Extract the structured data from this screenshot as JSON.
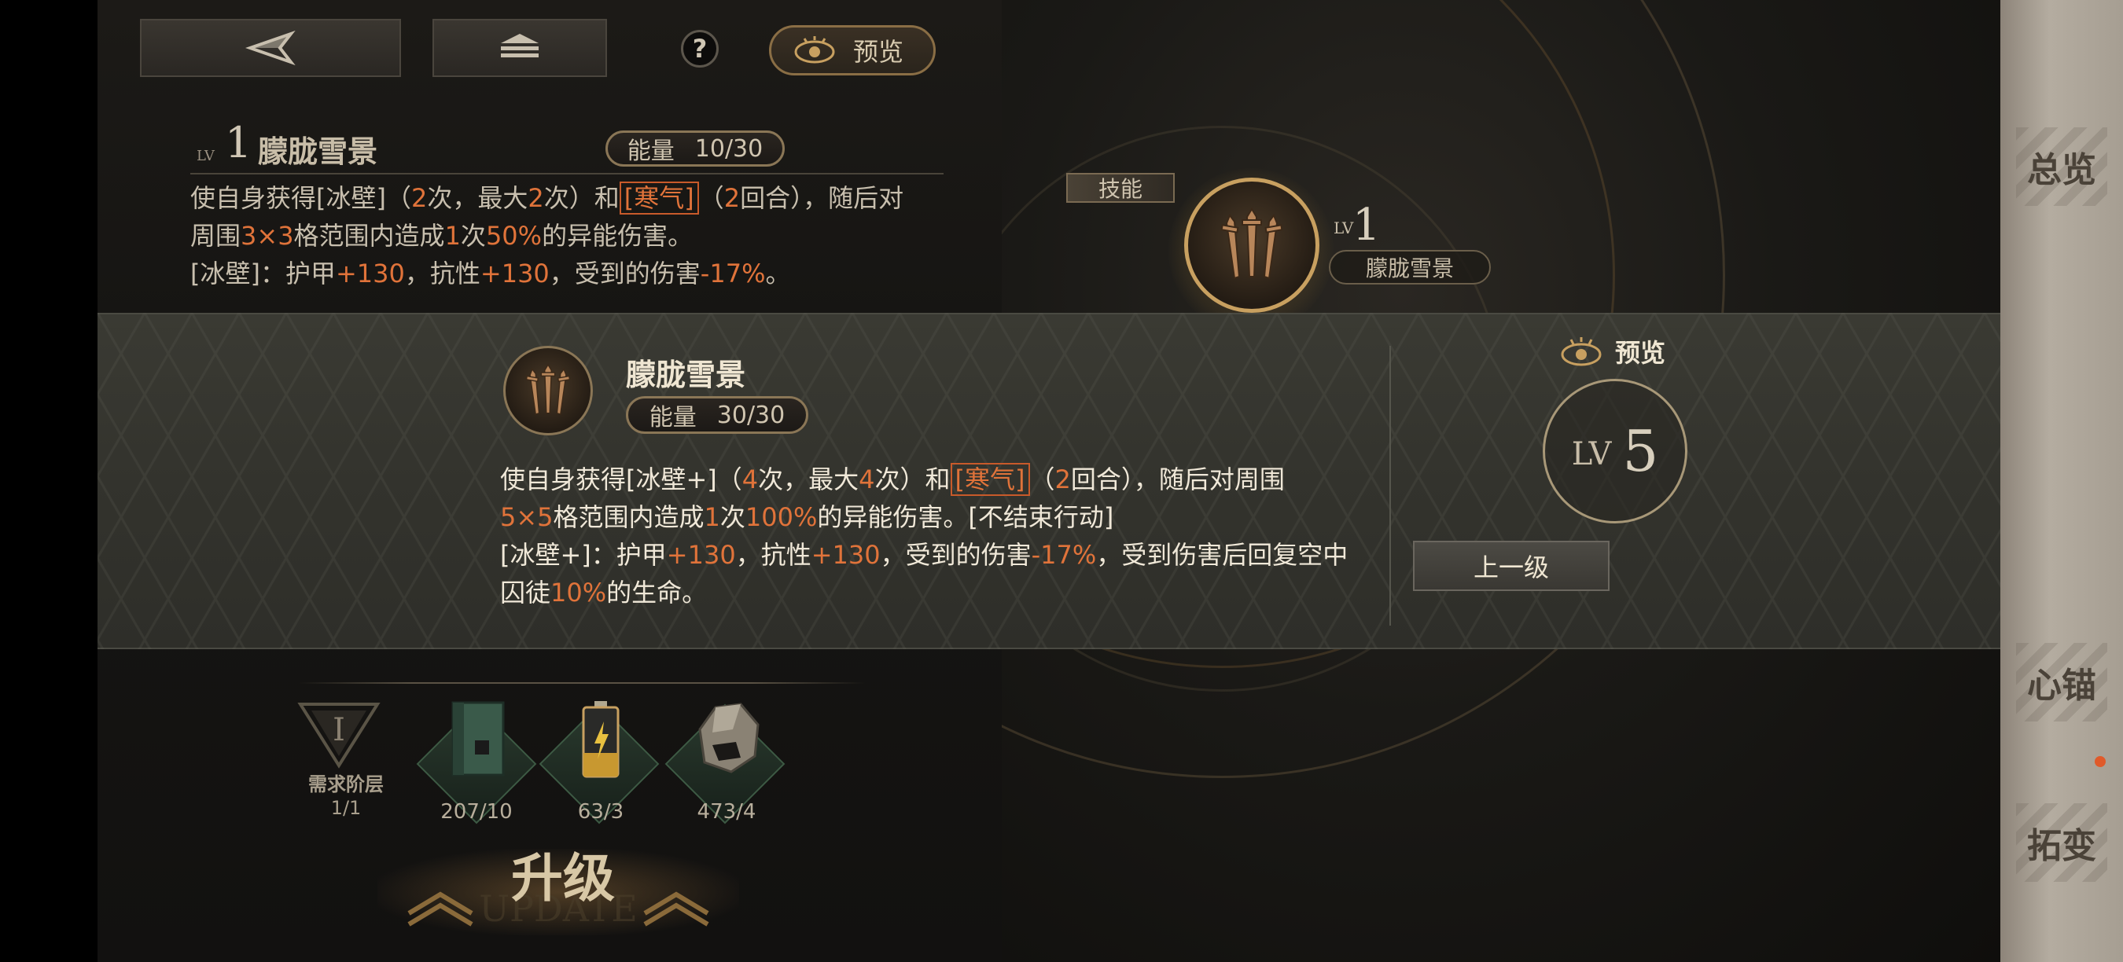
{
  "toolbar": {
    "back_icon": "back-arrow-icon",
    "home_icon": "stack-home-icon",
    "help_label": "?",
    "preview_label": "预览"
  },
  "current_skill": {
    "lv_prefix": "LV",
    "level": "1",
    "name": "朦胧雪景",
    "energy_label": "能量",
    "energy_value": "10/30",
    "desc_line1": [
      "使自身获得[冰壁]（",
      "2",
      "次，最大",
      "2",
      "次）和",
      "[寒气]",
      "（",
      "2",
      "回合），随后对"
    ],
    "desc_line2": [
      "周围",
      "3×3",
      "格范围内造成",
      "1",
      "次",
      "50%",
      "的异能伤害。"
    ],
    "desc_line3": [
      "[冰壁]：护甲",
      "+130",
      "，抗性",
      "+130",
      "，受到的伤害",
      "-17%",
      "。"
    ]
  },
  "popup": {
    "name": "朦胧雪景",
    "energy_label": "能量",
    "energy_value": "30/30",
    "desc_line1": [
      "使自身获得[冰壁+]（",
      "4",
      "次，最大",
      "4",
      "次）和",
      "[寒气]",
      "（",
      "2",
      "回合），随后对周围"
    ],
    "desc_line2": [
      "5×5",
      "格范围内造成",
      "1",
      "次",
      "100%",
      "的异能伤害。[不结束行动]"
    ],
    "desc_line3": [
      "[冰壁+]：护甲",
      "+130",
      "，抗性",
      "+130",
      "，受到的伤害",
      "-17%",
      "，受到伤害后回复空中"
    ],
    "desc_line4": [
      "囚徒",
      "10%",
      "的生命。"
    ],
    "preview_label": "预览",
    "lv_prefix": "LV",
    "level": "5",
    "prev_level_button": "上一级"
  },
  "node": {
    "tab_label": "技能",
    "lv_prefix": "LV",
    "level": "1",
    "name": "朦胧雪景"
  },
  "cost": {
    "tier_label": "需求阶层",
    "tier_count": "1/1",
    "tier_numeral": "I",
    "items": [
      {
        "icon": "book-icon",
        "count": "207/10"
      },
      {
        "icon": "battery-icon",
        "count": "63/3"
      },
      {
        "icon": "ore-rock-icon",
        "count": "473/4"
      }
    ],
    "upgrade_label": "升级",
    "upgrade_sub": "UPDATE"
  },
  "side_tabs": [
    "总览",
    "心锚",
    "拓变"
  ],
  "colors": {
    "highlight": "#e0733a",
    "gold": "#c8a060",
    "popup_bg": "#36362f"
  }
}
